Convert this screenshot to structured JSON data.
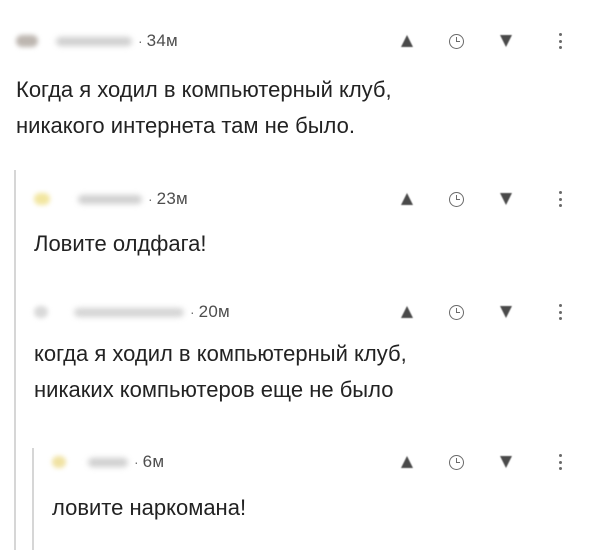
{
  "comments": [
    {
      "id": "c1",
      "time": "34м",
      "text_lines": [
        "Когда я ходил в компьютерный клуб,",
        "никакого интернета там не было."
      ]
    },
    {
      "id": "c2",
      "time": "23м",
      "text_lines": [
        "Ловите олдфага!"
      ]
    },
    {
      "id": "c3",
      "time": "20м",
      "text_lines": [
        "когда я ходил в компьютерный клуб,",
        "никаких компьютеров еще не было"
      ]
    },
    {
      "id": "c4",
      "time": "6м",
      "text_lines": [
        "ловите наркомана!"
      ]
    }
  ],
  "separator": "·",
  "icons": {
    "upvote": "triangle-up-icon",
    "save": "clock-icon",
    "downvote": "triangle-down-icon",
    "more": "vertical-ellipsis-icon"
  },
  "colors": {
    "avatar_1": "#bdb6b0",
    "avatar_2": "#f2e6a0",
    "avatar_3": "#d9d9d9",
    "avatar_4": "#f0e2a2",
    "username_blur": "#cfcfcf",
    "thread_line": "#d6d6d6"
  }
}
